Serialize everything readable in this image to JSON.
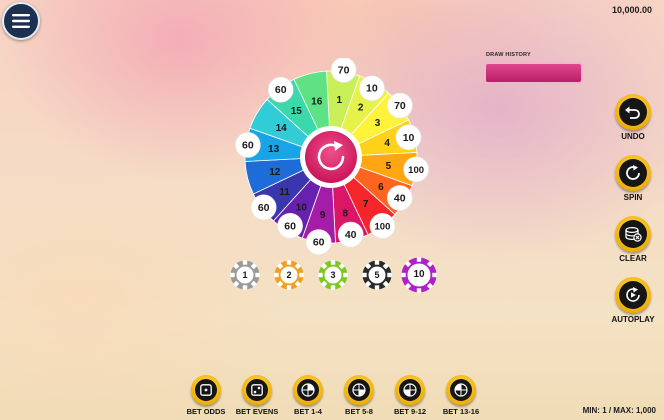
{
  "balance": "10,000.00",
  "draw_history": {
    "label": "DRAW HISTORY"
  },
  "wheel": {
    "segments": [
      {
        "number": "1",
        "payout": "70",
        "color": "#c8ef58"
      },
      {
        "number": "2",
        "payout": "10",
        "color": "#e6f24a"
      },
      {
        "number": "3",
        "payout": "70",
        "color": "#fff23a"
      },
      {
        "number": "4",
        "payout": "10",
        "color": "#ffd21a"
      },
      {
        "number": "5",
        "payout": "100",
        "color": "#ffa612"
      },
      {
        "number": "6",
        "payout": "40",
        "color": "#ff6420"
      },
      {
        "number": "7",
        "payout": "100",
        "color": "#f4262c"
      },
      {
        "number": "8",
        "payout": "40",
        "color": "#dc1666"
      },
      {
        "number": "9",
        "payout": "60",
        "color": "#a51ca8"
      },
      {
        "number": "10",
        "payout": "60",
        "color": "#6820ae"
      },
      {
        "number": "11",
        "payout": "60",
        "color": "#3a36ae"
      },
      {
        "number": "12",
        "payout": "",
        "color": "#1e6cd8"
      },
      {
        "number": "13",
        "payout": "60",
        "color": "#18a4e6"
      },
      {
        "number": "14",
        "payout": "",
        "color": "#32ccd6"
      },
      {
        "number": "15",
        "payout": "60",
        "color": "#3ad8aa"
      },
      {
        "number": "16",
        "payout": "",
        "color": "#5ee284"
      }
    ],
    "center_icon": "refresh-icon"
  },
  "chips": [
    {
      "value": "1",
      "color": "#9a9a9a"
    },
    {
      "value": "2",
      "color": "#f0a020"
    },
    {
      "value": "3",
      "color": "#7cc820"
    },
    {
      "value": "5",
      "color": "#2a2a2a"
    },
    {
      "value": "10",
      "color": "#b020c8"
    }
  ],
  "side_buttons": [
    {
      "label": "UNDO",
      "icon": "undo-icon"
    },
    {
      "label": "SPIN",
      "icon": "spin-icon"
    },
    {
      "label": "CLEAR",
      "icon": "clear-chips-icon"
    },
    {
      "label": "AUTOPLAY",
      "icon": "autoplay-icon"
    }
  ],
  "bet_buttons": [
    {
      "label": "BET ODDS",
      "icon": "die-odds-icon"
    },
    {
      "label": "BET EVENS",
      "icon": "die-evens-icon"
    },
    {
      "label": "BET 1-4",
      "icon": "quarter-1-icon"
    },
    {
      "label": "BET 5-8",
      "icon": "quarter-2-icon"
    },
    {
      "label": "BET 9-12",
      "icon": "quarter-3-icon"
    },
    {
      "label": "BET 13-16",
      "icon": "quarter-4-icon"
    }
  ],
  "limits": "MIN: 1 / MAX: 1,000"
}
